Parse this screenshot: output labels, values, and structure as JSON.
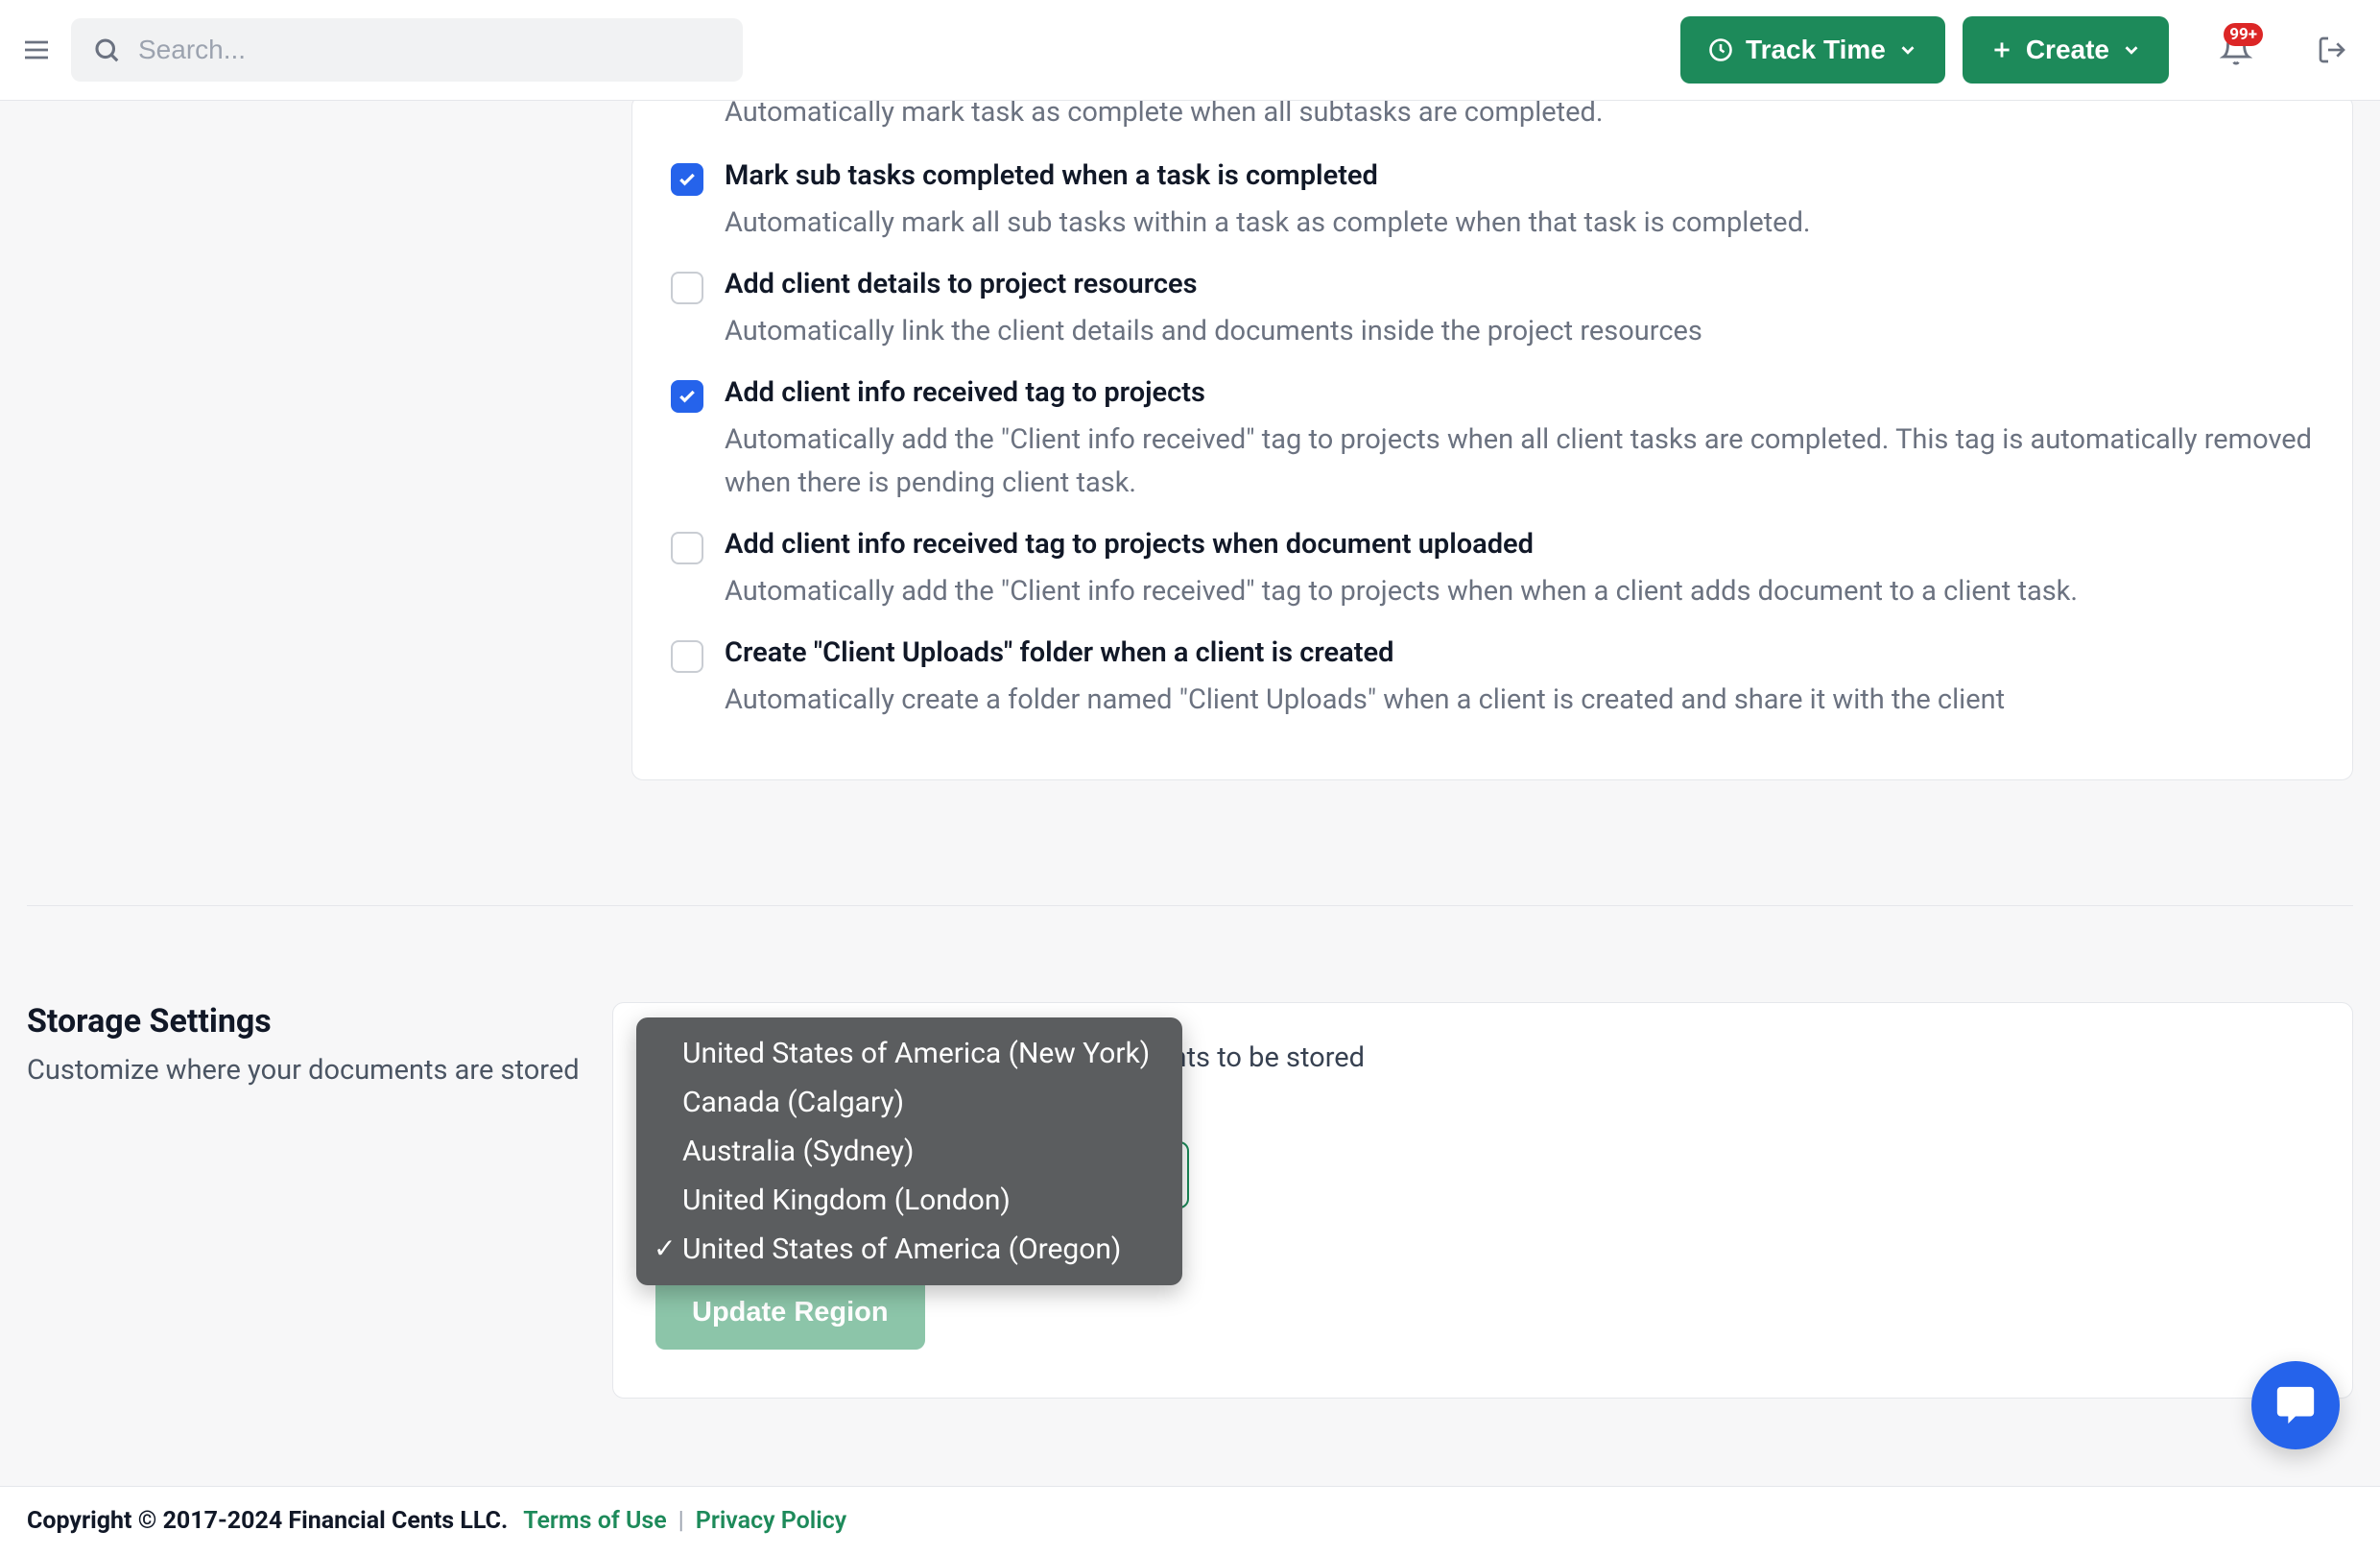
{
  "header": {
    "search_placeholder": "Search...",
    "track_time_label": "Track Time",
    "create_label": "Create",
    "badge": "99+"
  },
  "settings_top": {
    "truncated_desc": "Automatically mark task as complete when all subtasks are completed.",
    "items": [
      {
        "checked": true,
        "title": "Mark sub tasks completed when a task is completed",
        "desc": "Automatically mark all sub tasks within a task as complete when that task is completed."
      },
      {
        "checked": false,
        "title": "Add client details to project resources",
        "desc": "Automatically link the client details and documents inside the project resources"
      },
      {
        "checked": true,
        "title": "Add client info received tag to projects",
        "desc": "Automatically add the \"Client info received\" tag to projects when all client tasks are completed. This tag is automatically removed when there is pending client task."
      },
      {
        "checked": false,
        "title": "Add client info received tag to projects when document uploaded",
        "desc": "Automatically add the \"Client info received\" tag to projects when when a client adds document to a client task."
      },
      {
        "checked": false,
        "title": "Create \"Client Uploads\" folder when a client is created",
        "desc": "Automatically create a folder named \"Client Uploads\" when a client is created and share it with the client"
      }
    ]
  },
  "storage": {
    "title": "Storage Settings",
    "subtitle": "Customize where your documents are stored",
    "prompt_visible_fragment": "documents to be stored",
    "update_label": "Update Region",
    "options": [
      "United States of America (New York)",
      "Canada (Calgary)",
      "Australia (Sydney)",
      "United Kingdom (London)",
      "United States of America (Oregon)"
    ],
    "selected_index": 4
  },
  "footer": {
    "copyright": "Copyright © 2017-2024 Financial Cents LLC.",
    "terms": "Terms of Use",
    "privacy": "Privacy Policy"
  }
}
